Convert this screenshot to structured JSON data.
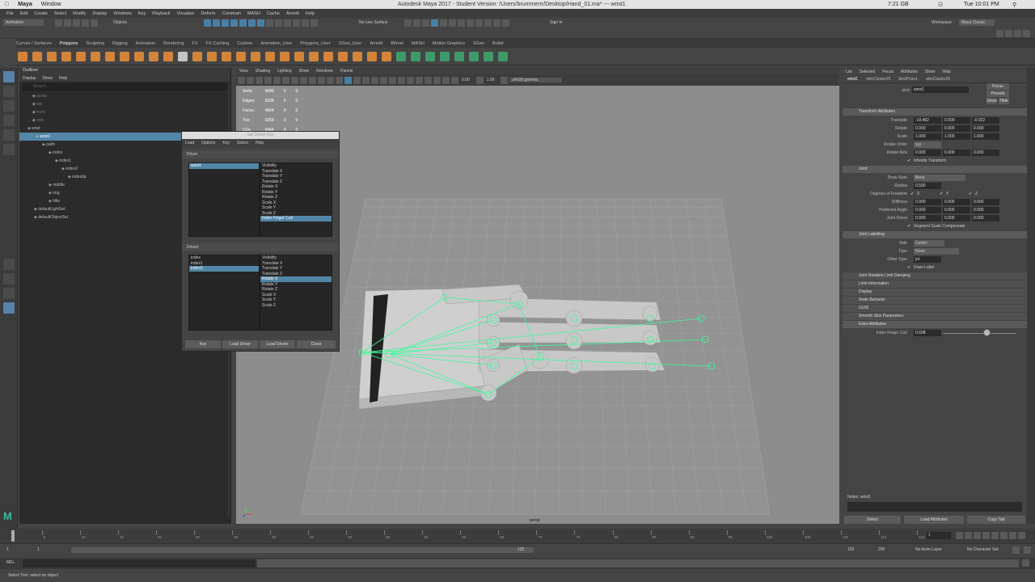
{
  "os_menu": {
    "apple": "",
    "app": "Maya",
    "window": "Window",
    "battery": "7:21 GB",
    "time": "Tue 10:01 PM"
  },
  "title": "Autodesk Maya 2017 - Student Version: /Users/brummerrr/Desktop/Hand_01.ma* --- wrist1",
  "main_menu": [
    "File",
    "Edit",
    "Create",
    "Select",
    "Modify",
    "Display",
    "Windows",
    "Key",
    "Playback",
    "Visualize",
    "Deform",
    "Constrain",
    "MASH",
    "Cache",
    "Arnold",
    "Help"
  ],
  "status": {
    "mode": "Animation",
    "objects": "Objects",
    "live": "No Live Surface",
    "signin": "Sign In",
    "workspace_label": "Workspace :",
    "workspace": "Maya Classic"
  },
  "shelf_tabs": [
    "Curves / Surfaces",
    "Polygons",
    "Sculpting",
    "Rigging",
    "Animation",
    "Rendering",
    "FX",
    "FX Caching",
    "Custom",
    "Animation_User",
    "Polygons_User",
    "XGen_User",
    "Arnold",
    "Bifrost",
    "MASH",
    "Motion Graphics",
    "XGen",
    "Bullet"
  ],
  "shelf_active": "Polygons",
  "outliner": {
    "title": "Outliner",
    "menu": [
      "Display",
      "Show",
      "Help"
    ],
    "search": "Search...",
    "rows": [
      {
        "label": "persp",
        "indent": 16,
        "sel": false,
        "dim": true
      },
      {
        "label": "top",
        "indent": 16,
        "sel": false,
        "dim": true
      },
      {
        "label": "front",
        "indent": 16,
        "sel": false,
        "dim": true
      },
      {
        "label": "side",
        "indent": 16,
        "sel": false,
        "dim": true
      },
      {
        "label": "wrist",
        "indent": 10,
        "sel": false,
        "dim": false
      },
      {
        "label": "wrist1",
        "indent": 20,
        "sel": true,
        "dim": false
      },
      {
        "label": "palm",
        "indent": 28,
        "sel": false,
        "dim": false
      },
      {
        "label": "index",
        "indent": 36,
        "sel": false,
        "dim": false
      },
      {
        "label": "index1",
        "indent": 44,
        "sel": false,
        "dim": false
      },
      {
        "label": "index2",
        "indent": 52,
        "sel": false,
        "dim": false
      },
      {
        "label": "indextip",
        "indent": 60,
        "sel": false,
        "dim": false
      },
      {
        "label": "middle",
        "indent": 36,
        "sel": false,
        "dim": false
      },
      {
        "label": "ring",
        "indent": 36,
        "sel": false,
        "dim": false
      },
      {
        "label": "little",
        "indent": 36,
        "sel": false,
        "dim": false
      },
      {
        "label": "defaultLightSet",
        "indent": 18,
        "sel": false,
        "dim": false
      },
      {
        "label": "defaultObjectSet",
        "indent": 18,
        "sel": false,
        "dim": false
      }
    ]
  },
  "viewport": {
    "menu": [
      "View",
      "Shading",
      "Lighting",
      "Show",
      "Renderer",
      "Panels"
    ],
    "field1": "0.00",
    "field2": "1.00",
    "colorspace": "sRGB gamma",
    "camera": "persp",
    "hud": [
      [
        "Verts:",
        "4696",
        "0",
        "0"
      ],
      [
        "Edges:",
        "9328",
        "0",
        "0"
      ],
      [
        "Faces:",
        "4664",
        "0",
        "0"
      ],
      [
        "Tris:",
        "9268",
        "0",
        "0"
      ],
      [
        "UVs:",
        "5464",
        "0",
        "0"
      ]
    ]
  },
  "sdk": {
    "title": "Set Driven Key",
    "menu": [
      "Load",
      "Options",
      "Key",
      "Select",
      "Help"
    ],
    "driver_label": "Driver",
    "driven_label": "Driven",
    "driver_objects": [
      "wrist1"
    ],
    "driver_attrs": [
      "Visibility",
      "Translate X",
      "Translate Y",
      "Translate Z",
      "Rotate X",
      "Rotate Y",
      "Rotate Z",
      "Scale X",
      "Scale Y",
      "Scale Z",
      "Index Finger Curl"
    ],
    "driven_objects": [
      "index",
      "index1",
      "index2"
    ],
    "driven_attrs": [
      "Visibility",
      "Translate X",
      "Translate Y",
      "Translate Z",
      "Rotate X",
      "Rotate Y",
      "Rotate Z",
      "Scale X",
      "Scale Y",
      "Scale Z"
    ],
    "buttons": [
      "Key",
      "Load Driver",
      "Load Driven",
      "Close"
    ]
  },
  "ae": {
    "menu": [
      "List",
      "Selected",
      "Focus",
      "Attributes",
      "Show",
      "Help"
    ],
    "tabs": [
      "wrist1",
      "skinCluster26",
      "bindPose1",
      "skinCluster25"
    ],
    "joint_label": "joint:",
    "joint_value": "wrist1",
    "focus": "Focus",
    "presets": "Presets",
    "show": "Show",
    "hide": "Hide",
    "sections": {
      "transform": "Transform Attributes",
      "joint": "Joint",
      "labelling": "Joint Labelling",
      "limit_damp": "Joint Rotation Limit Damping",
      "limit_info": "Limit Information",
      "display": "Display",
      "node_behavior": "Node Behavior",
      "uuid": "UUID",
      "smooth": "Smooth Skin Parameters",
      "extra": "Extra Attributes"
    },
    "translate": {
      "label": "Translate",
      "v": [
        "-10.462",
        "0.000",
        "-0.022"
      ]
    },
    "rotate": {
      "label": "Rotate",
      "v": [
        "0.000",
        "0.000",
        "0.000"
      ]
    },
    "scale": {
      "label": "Scale",
      "v": [
        "1.000",
        "1.000",
        "1.000"
      ]
    },
    "rotate_order": {
      "label": "Rotate Order",
      "v": "xyz"
    },
    "rotate_axis": {
      "label": "Rotate Axis",
      "v": [
        "0.000",
        "0.000",
        "0.000"
      ]
    },
    "inherits": "Inherits Transform",
    "draw_style": {
      "label": "Draw Style",
      "v": "Bone"
    },
    "radius": {
      "label": "Radius",
      "v": "0.500"
    },
    "dof": {
      "label": "Degrees of Freedom",
      "x": "X",
      "y": "Y",
      "z": "Z"
    },
    "stiffness": {
      "label": "Stiffness",
      "v": [
        "0.000",
        "0.000",
        "0.000"
      ]
    },
    "pref_angle": {
      "label": "Preferred Angle",
      "v": [
        "0.000",
        "0.000",
        "0.000"
      ]
    },
    "joint_orient": {
      "label": "Joint Orient",
      "v": [
        "0.000",
        "0.000",
        "0.000"
      ]
    },
    "segment": "Segment Scale Compensate",
    "side": {
      "label": "Side",
      "v": "Center"
    },
    "type": {
      "label": "Type",
      "v": "None"
    },
    "other_type": {
      "label": "Other Type",
      "v": "jnt"
    },
    "draw_label": "Draw Label",
    "curl": {
      "label": "Index Finger Curl",
      "v": "0.608",
      "slider": 0.6
    },
    "notes": "Notes: wrist1",
    "bottom": [
      "Select",
      "Load Attributes",
      "Copy Tab"
    ]
  },
  "time": {
    "ticks": [
      1,
      5,
      10,
      15,
      20,
      25,
      30,
      35,
      40,
      45,
      50,
      55,
      60,
      65,
      70,
      75,
      80,
      85,
      90,
      95,
      100,
      105,
      110,
      115,
      120
    ],
    "current": "1",
    "start": "1",
    "start2": "1",
    "range_mid": "120",
    "end": "120",
    "end2": "200",
    "anim_layer": "No Anim Layer",
    "char_set": "No Character Set"
  },
  "cmd_label": "MEL",
  "help_line": "Select Tool: select an object"
}
